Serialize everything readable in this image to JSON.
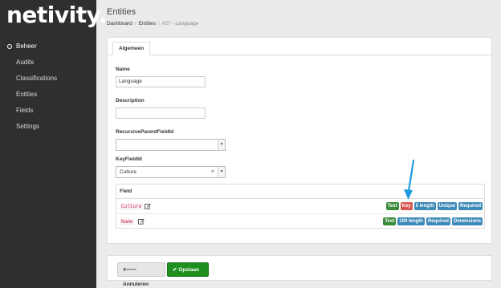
{
  "brand": {
    "logo_text": "netivity."
  },
  "sidebar": {
    "items": [
      {
        "label": "Beheer"
      },
      {
        "label": "Audits"
      },
      {
        "label": "Classifications"
      },
      {
        "label": "Entities"
      },
      {
        "label": "Fields"
      },
      {
        "label": "Settings"
      }
    ]
  },
  "header": {
    "title": "Entities",
    "breadcrumb": [
      "Dashboard",
      "Entities",
      "#27 - Language"
    ]
  },
  "tabs": [
    {
      "label": "Algemeen"
    }
  ],
  "form": {
    "name": {
      "label": "Name",
      "value": "Language"
    },
    "description": {
      "label": "Description",
      "value": ""
    },
    "recursive_parent": {
      "label": "RecursiveParentFieldId",
      "value": ""
    },
    "key_field": {
      "label": "KeyFieldId",
      "value": "Culture",
      "clear": "×"
    }
  },
  "fields_table": {
    "header": "Field",
    "rows": [
      {
        "name": "Culture",
        "badges": [
          {
            "text": "Text",
            "color": "#3a8a3a"
          },
          {
            "text": "Key",
            "color": "#d9534f"
          },
          {
            "text": "5 length",
            "color": "#3d89b7"
          },
          {
            "text": "Unique",
            "color": "#3d89b7"
          },
          {
            "text": "Required",
            "color": "#3d89b7"
          }
        ]
      },
      {
        "name": "Name",
        "badges": [
          {
            "text": "Text",
            "color": "#3a8a3a"
          },
          {
            "text": "100 length",
            "color": "#3d89b7"
          },
          {
            "text": "Required",
            "color": "#3d89b7"
          },
          {
            "text": "Dimensions",
            "color": "#3d89b7"
          }
        ]
      }
    ]
  },
  "actions": {
    "cancel_label": "Annuleren",
    "save_label": "Opslaan"
  },
  "colors": {
    "sidebar_bg": "#2f2f2f",
    "annotation_arrow": "#1d9be0",
    "save_button": "#1f8f1f"
  },
  "icons": [
    "edit-icon",
    "arrow-left-icon",
    "check-icon",
    "chevron-down-icon"
  ]
}
